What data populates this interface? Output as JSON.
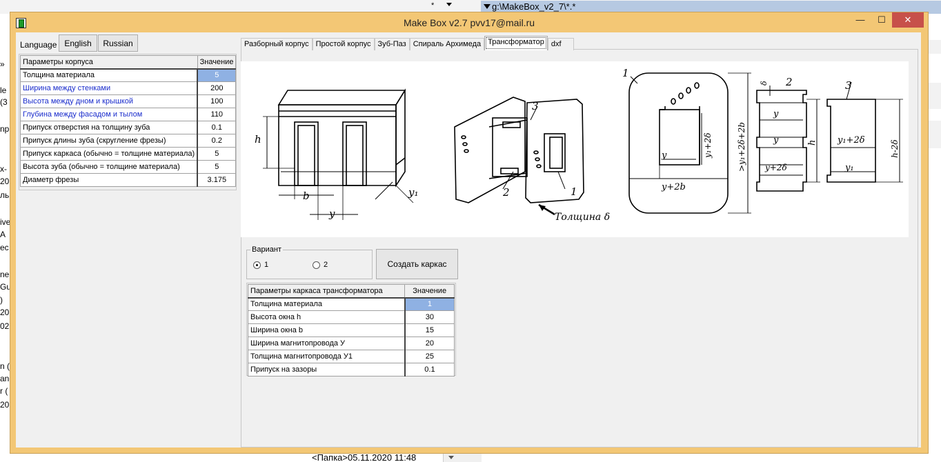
{
  "background": {
    "top_star": "*",
    "path_text": "g:\\MakeBox_v2_7\\*.*",
    "left_fragments": [
      "»",
      "le",
      "(3",
      "np",
      "x-",
      "20",
      "ль",
      "ive",
      "A",
      "ec",
      "ne",
      "Gu",
      ")",
      "20",
      "02",
      "n (",
      "anc",
      "r (",
      "20"
    ],
    "bottom_text": "<Папка>05.11.2020 11:48"
  },
  "window": {
    "title": "Make Box v2.7  pvv17@mail.ru",
    "minimize": "—",
    "maximize": "☐",
    "close": "✕"
  },
  "language": {
    "label": "Language",
    "english": "English",
    "russian": "Russian"
  },
  "params_table": {
    "header": [
      "Параметры корпуса",
      "Значение"
    ],
    "rows": [
      {
        "name": "Толщина материала",
        "value": "5"
      },
      {
        "name": "Ширина между стенками",
        "value": "200"
      },
      {
        "name": "Высота между дном и крышкой",
        "value": "100"
      },
      {
        "name": "Глубина между фасадом и тылом",
        "value": "110"
      },
      {
        "name": "Припуск отверстия на толщину зуба",
        "value": "0.1"
      },
      {
        "name": "Припуск длины зуба (скругление фрезы)",
        "value": "0.2"
      },
      {
        "name": "Припуск каркаса (обычно = толщине материала)",
        "value": "5"
      },
      {
        "name": "Высота зуба (обычно = толщине материала)",
        "value": "5"
      },
      {
        "name": "Диаметр фрезы",
        "value": "3.175"
      }
    ]
  },
  "tabs": [
    "Разборный корпус",
    "Простой корпус",
    "Зуб-Паз",
    "Спираль Архимеда",
    "Трансформатор",
    "dxf"
  ],
  "active_tab": "Трансформатор",
  "drawing_labels": {
    "h": "h",
    "b": "b",
    "y": "y",
    "y1": "y₁",
    "n1": "1",
    "n2": "2",
    "n3": "3",
    "thickness": "Толщина δ",
    "ooo": "o o o",
    "y2b": "y+2b",
    "y12d": "y₁+2δ",
    "big": ">y₁+2δ+2b",
    "yplus": "y+2δ",
    "h2d": "h-2δ",
    "delta": "δ"
  },
  "variant": {
    "legend": "Вариант",
    "option1": "1",
    "option2": "2",
    "selected": "1"
  },
  "create_button": "Создать каркас",
  "transformer_table": {
    "header": [
      "Параметры каркаса трансформатора",
      "Значение"
    ],
    "rows": [
      {
        "name": "Толщина материала",
        "value": "1"
      },
      {
        "name": "Высота окна h",
        "value": "30"
      },
      {
        "name": "Ширина окна b",
        "value": "15"
      },
      {
        "name": "Ширина магнитопровода  У",
        "value": "20"
      },
      {
        "name": "Толщина магнитопровода У1",
        "value": "25"
      },
      {
        "name": "Припуск на зазоры",
        "value": "0.1"
      }
    ]
  }
}
